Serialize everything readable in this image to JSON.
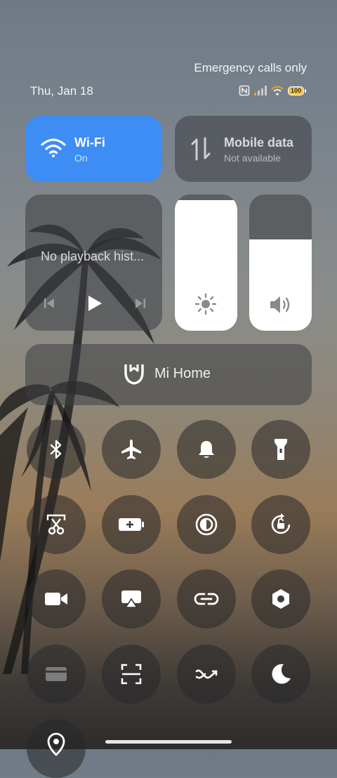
{
  "status": {
    "carrier_text": "Emergency calls only",
    "date": "Thu, Jan 18",
    "battery": "100"
  },
  "wifi": {
    "title": "Wi-Fi",
    "subtitle": "On",
    "color": "#3e8df5"
  },
  "mobile_data": {
    "title": "Mobile data",
    "subtitle": "Not available"
  },
  "media": {
    "text": "No playback hist..."
  },
  "brightness": {
    "level": 0.96
  },
  "volume": {
    "level": 0.67
  },
  "mi_home": {
    "label": "Mi Home"
  },
  "toggles": [
    "bluetooth-icon",
    "airplane-icon",
    "bell-icon",
    "flashlight-icon",
    "screenshot-icon",
    "battery-saver-icon",
    "dark-mode-icon",
    "rotation-lock-icon",
    "video-camera-icon",
    "cast-icon",
    "link-icon",
    "settings-hexagon-icon",
    "card-icon",
    "scanner-icon",
    "data-saver-icon",
    "moon-icon",
    "location-icon"
  ]
}
